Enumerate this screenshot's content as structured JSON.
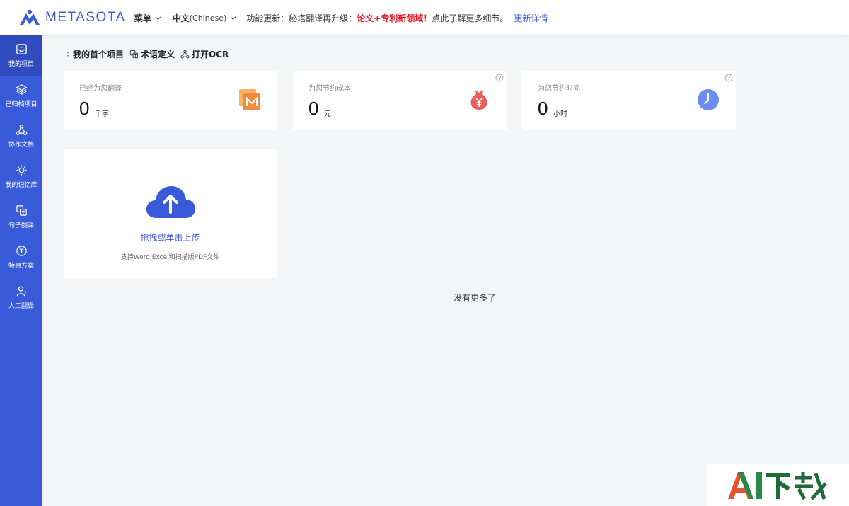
{
  "header": {
    "brand": "METASOTA",
    "menu_label": "菜单",
    "lang_label": "中文",
    "lang_sub": "(Chinese)",
    "notice_prefix": "功能更新：秘塔翻译再升级：",
    "notice_highlight": "论文+专利新领域！",
    "notice_suffix": "点此了解更多细节。",
    "notice_link": "更新详情"
  },
  "sidebar": {
    "items": [
      {
        "label": "我的项目",
        "icon": "inbox-icon",
        "active": true
      },
      {
        "label": "已归档项目",
        "icon": "layers-icon",
        "active": false
      },
      {
        "label": "协作文档",
        "icon": "share-icon",
        "active": false
      },
      {
        "label": "我的记忆库",
        "icon": "bulb-icon",
        "active": false
      },
      {
        "label": "句子翻译",
        "icon": "translate-icon",
        "active": false
      },
      {
        "label": "特惠方案",
        "icon": "discount-icon",
        "active": false
      },
      {
        "label": "人工翻译",
        "icon": "person-icon",
        "active": false
      }
    ]
  },
  "toolbar": {
    "project_label": "我的首个项目",
    "glossary_label": "术语定义",
    "ocr_label": "打开OCR"
  },
  "stats": [
    {
      "label": "已经为您翻译",
      "value": "0",
      "unit": "千字"
    },
    {
      "label": "为您节约成本",
      "value": "0",
      "unit": "元"
    },
    {
      "label": "为您节约时间",
      "value": "0",
      "unit": "小时"
    }
  ],
  "upload": {
    "title": "拖拽或单击上传",
    "subtitle": "支持Word,Excel和扫描版PDF文件"
  },
  "list_end": "没有更多了",
  "watermark": "AI下载",
  "colors": {
    "accent": "#3a5bd9",
    "highlight": "#e0222b"
  }
}
